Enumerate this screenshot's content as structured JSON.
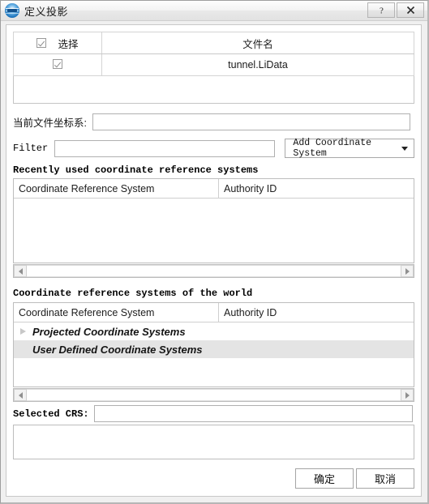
{
  "window": {
    "title": "定义投影",
    "logo_icon": "lidar-globe-logo-icon",
    "help_button": "?",
    "close_button": "✕"
  },
  "file_table": {
    "columns": [
      "选择",
      "文件名"
    ],
    "header_checkbox_checked": true,
    "rows": [
      {
        "selected": true,
        "filename": "tunnel.LiData"
      }
    ]
  },
  "current_crs": {
    "label": "当前文件坐标系:",
    "value": "",
    "placeholder": ""
  },
  "filter": {
    "label": "Filter",
    "value": "",
    "placeholder": ""
  },
  "add_coordinate_system": {
    "label": "Add Coordinate System",
    "caret_icon": "chevron-down-icon"
  },
  "recent_section": {
    "title": "Recently used coordinate reference systems",
    "columns": [
      "Coordinate Reference System",
      "Authority ID"
    ],
    "rows": []
  },
  "world_section": {
    "title": "Coordinate reference systems of the world",
    "columns": [
      "Coordinate Reference System",
      "Authority ID"
    ],
    "rows": [
      {
        "label": "Projected Coordinate Systems",
        "expandable": true,
        "selected": false
      },
      {
        "label": "User Defined Coordinate Systems",
        "expandable": false,
        "selected": true
      }
    ]
  },
  "selected_crs": {
    "label": "Selected CRS:",
    "value": "",
    "placeholder": ""
  },
  "details_box": {
    "value": ""
  },
  "buttons": {
    "ok": "确定",
    "cancel": "取消"
  },
  "colors": {
    "window_bg": "#f0f0f0",
    "content_bg": "#ffffff",
    "border": "#c8c8c8",
    "selection": "#e4e4e4",
    "logo_blue": "#1c74bd"
  }
}
